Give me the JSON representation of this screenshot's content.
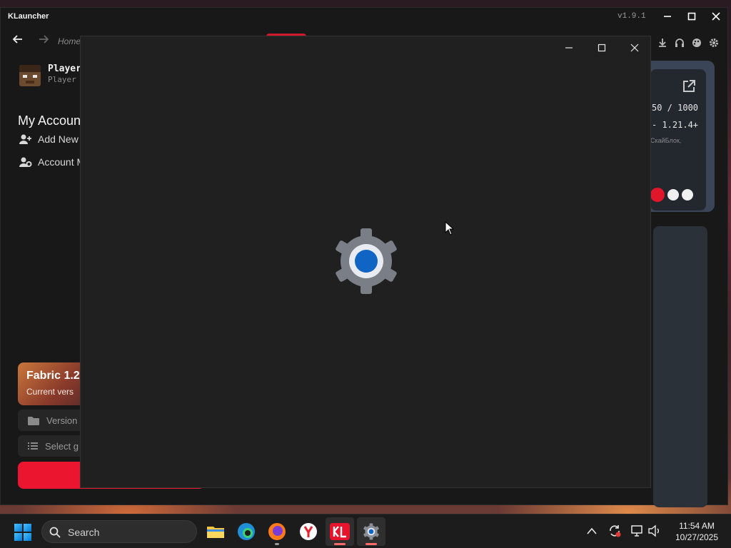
{
  "launcher": {
    "title": "KLauncher",
    "version": "v1.9.1",
    "breadcrumb": "Home",
    "profile": {
      "name": "Player",
      "type": "Player"
    },
    "section_title": "My Accoun",
    "menu": [
      {
        "label": "Add New",
        "icon": "user-plus-icon"
      },
      {
        "label": "Account M",
        "icon": "user-gear-icon"
      }
    ],
    "version_card": {
      "title": "Fabric 1.2",
      "subtitle": "Current vers"
    },
    "version_button": "Version",
    "select_button": "Select g",
    "toolbar_icons": [
      "download-icon",
      "headset-icon",
      "palette-icon",
      "gear-icon"
    ],
    "server": {
      "players": "50 / 1000",
      "version": "- 1.21.4+",
      "description": "СкайБлок,"
    },
    "colors": {
      "accent": "#ec1530",
      "panel": "#181818"
    }
  },
  "settings_splash": {
    "icon": "settings-gear-icon",
    "controls": [
      "minimize",
      "maximize",
      "close"
    ]
  },
  "taskbar": {
    "search_placeholder": "Search",
    "apps": [
      "file-explorer-icon",
      "edge-icon",
      "firefox-icon",
      "yandex-icon",
      "klauncher-icon",
      "settings-icon"
    ],
    "clock_time": "11:54 AM",
    "clock_date": "10/27/2025"
  }
}
